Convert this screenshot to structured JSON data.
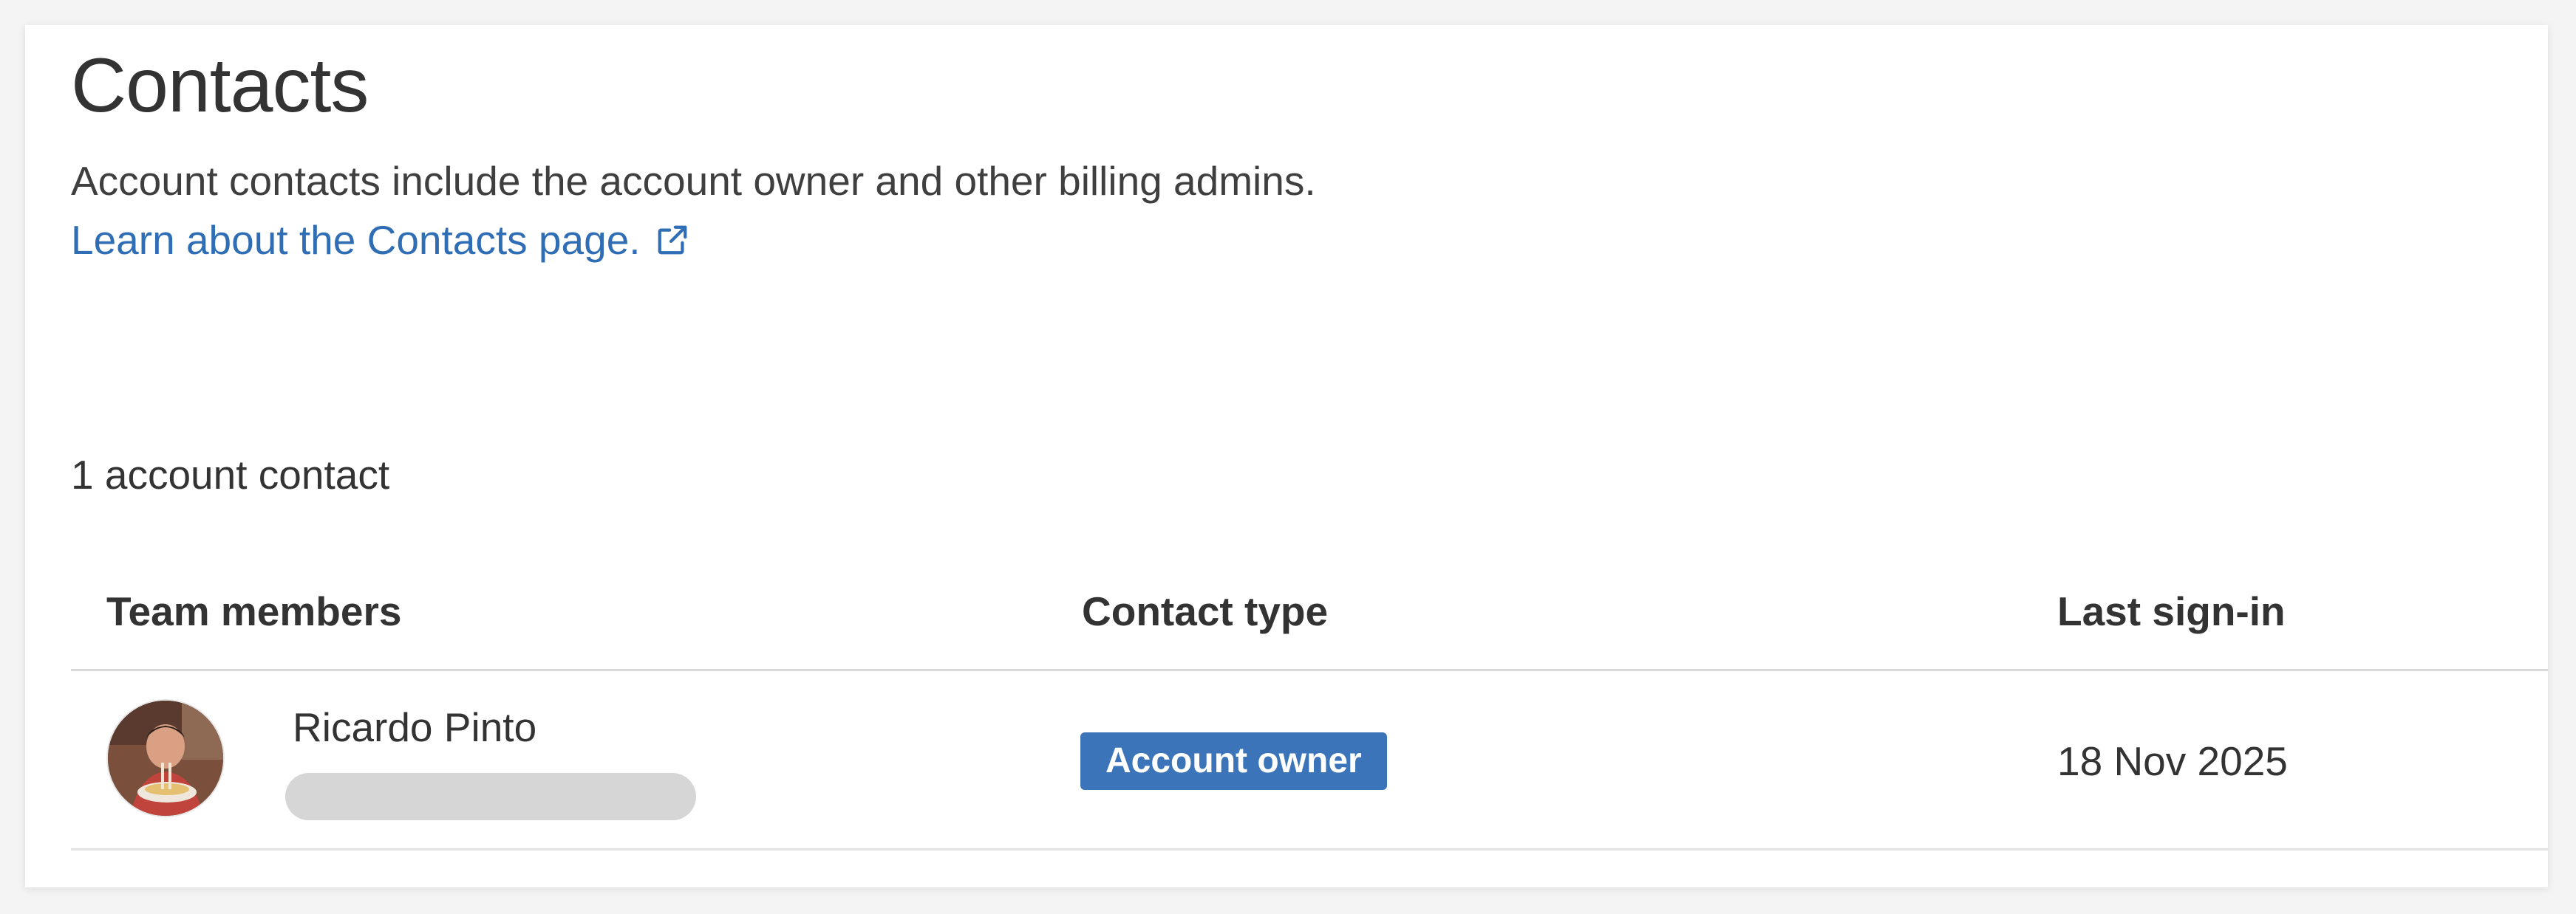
{
  "page": {
    "title": "Contacts",
    "description": "Account contacts include the account owner and other billing admins.",
    "learn_link_label": "Learn about the Contacts page.",
    "learn_link_icon": "external-link-icon",
    "contact_count_text": "1 account contact"
  },
  "table": {
    "headers": {
      "members": "Team members",
      "type": "Contact type",
      "last_signin": "Last sign-in"
    },
    "rows": [
      {
        "name": "Ricardo Pinto",
        "email": "",
        "contact_type": "Account owner",
        "last_signin": "18 Nov 2025"
      }
    ]
  },
  "colors": {
    "link": "#2f6db5",
    "badge_bg": "#3b74b9",
    "badge_text": "#ffffff",
    "redaction": "#d6d6d7"
  }
}
